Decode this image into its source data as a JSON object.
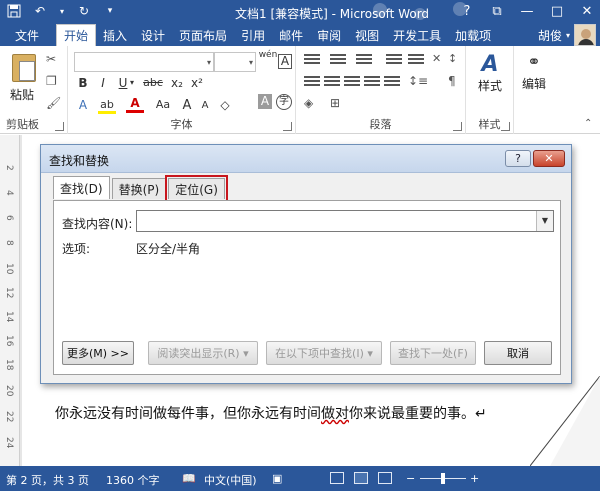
{
  "window": {
    "title": "文档1 [兼容模式] - Microsoft Word",
    "qat": {
      "save_icon": "save-icon",
      "undo_icon": "undo-icon",
      "redo_icon": "redo-icon"
    },
    "controls": {
      "help": "?",
      "restore": "⧉",
      "minimize": "—",
      "maximize": "□",
      "close": "✕"
    }
  },
  "ribbon": {
    "file_tab": "文件",
    "tabs": [
      "开始",
      "插入",
      "设计",
      "页面布局",
      "引用",
      "邮件",
      "审阅",
      "视图",
      "开发工具",
      "加载项"
    ],
    "active_tab": "开始",
    "user_name": "胡俊",
    "groups": {
      "clipboard": {
        "label": "剪贴板",
        "paste": "粘贴"
      },
      "font": {
        "label": "字体",
        "font_name": "",
        "font_size": "",
        "wen": "wén",
        "a_box": "A",
        "bold": "B",
        "italic": "I",
        "underline": "U",
        "strike": "abc",
        "sub": "x₂",
        "sup": "x²",
        "highlight": "ab",
        "font_color": "A",
        "aa": "Aa",
        "grow": "A",
        "shrink": "A"
      },
      "paragraph": {
        "label": "段落"
      },
      "styles": {
        "label": "样式",
        "button": "样式"
      },
      "editing": {
        "button": "编辑"
      }
    }
  },
  "dialog": {
    "title": "查找和替换",
    "help": "?",
    "close": "✕",
    "tabs": [
      {
        "label": "查找(D)"
      },
      {
        "label": "替换(P)"
      },
      {
        "label": "定位(G)"
      }
    ],
    "find_label": "查找内容(N):",
    "find_value": "",
    "options_label": "选项:",
    "options_value": "区分全/半角",
    "buttons": {
      "more": "更多(M) >>",
      "reading_highlight": "阅读突出显示(R) ▾",
      "find_in": "在以下项中查找(I) ▾",
      "find_next": "查找下一处(F)",
      "cancel": "取消"
    }
  },
  "document": {
    "text_before": "你永远没有时间做每件事，但你永远有时间",
    "text_squiggle": "做对",
    "text_after": "你来说最重要的事。↵",
    "ruler_marks": [
      "2",
      "4",
      "6",
      "8",
      "10",
      "12",
      "14",
      "16",
      "18",
      "20",
      "22",
      "24"
    ]
  },
  "status": {
    "page": "第 2 页，共 3 页",
    "words": "1360 个字",
    "language": "中文(中国)",
    "zoom": 1.0
  }
}
